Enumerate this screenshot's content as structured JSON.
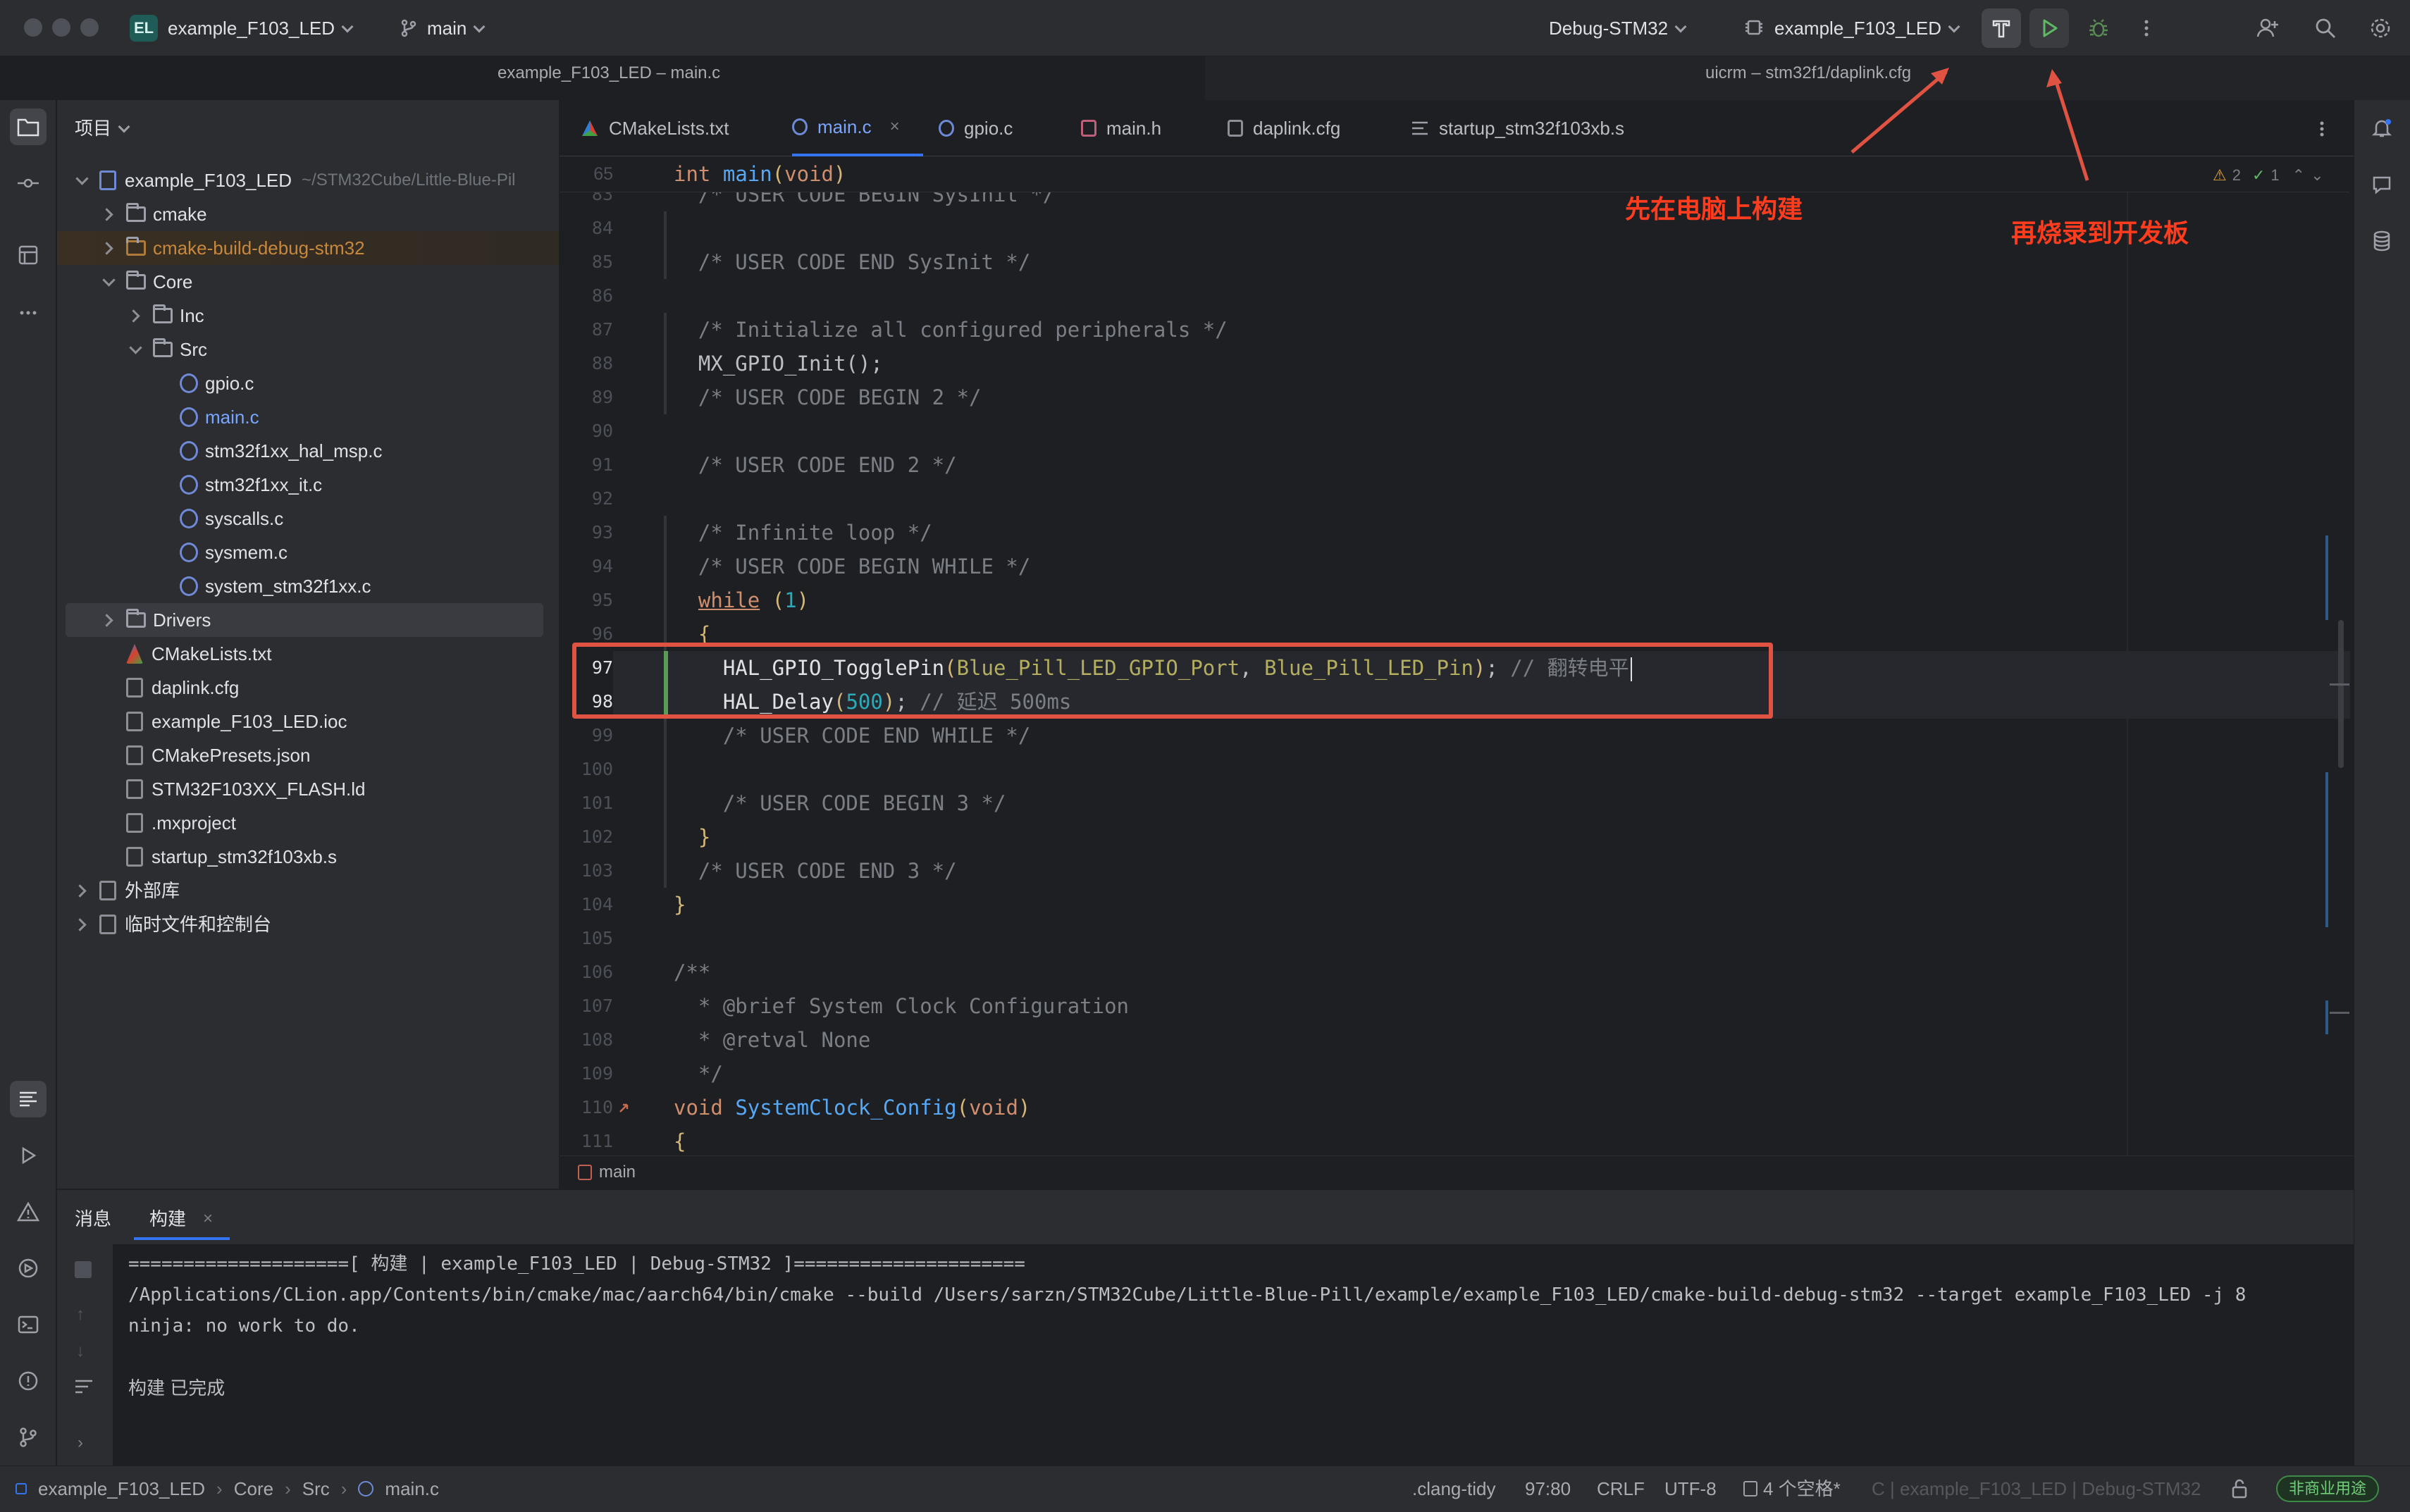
{
  "titlebar": {
    "project_badge": "EL",
    "project_name": "example_F103_LED",
    "branch": "main",
    "run_config": "Debug-STM32",
    "target": "example_F103_LED"
  },
  "subtitle": {
    "left": "example_F103_LED – main.c",
    "right": "uicrm – stm32f1/daplink.cfg"
  },
  "project_panel": {
    "header": "项目",
    "items": [
      {
        "label": "example_F103_LED",
        "suffix": "~/STM32Cube/Little-Blue-Pil",
        "depth": 0,
        "arrow": "down",
        "icon": "module",
        "style": "normal"
      },
      {
        "label": "cmake",
        "depth": 1,
        "arrow": "right",
        "icon": "folder",
        "style": "normal"
      },
      {
        "label": "cmake-build-debug-stm32",
        "depth": 1,
        "arrow": "right",
        "icon": "folder",
        "style": "excluded"
      },
      {
        "label": "Core",
        "depth": 1,
        "arrow": "down",
        "icon": "folder",
        "style": "normal"
      },
      {
        "label": "Inc",
        "depth": 2,
        "arrow": "right",
        "icon": "folder",
        "style": "normal"
      },
      {
        "label": "Src",
        "depth": 2,
        "arrow": "down",
        "icon": "folder",
        "style": "normal"
      },
      {
        "label": "gpio.c",
        "depth": 3,
        "arrow": "none",
        "icon": "c",
        "style": "normal"
      },
      {
        "label": "main.c",
        "depth": 3,
        "arrow": "none",
        "icon": "c",
        "style": "active"
      },
      {
        "label": "stm32f1xx_hal_msp.c",
        "depth": 3,
        "arrow": "none",
        "icon": "c",
        "style": "normal"
      },
      {
        "label": "stm32f1xx_it.c",
        "depth": 3,
        "arrow": "none",
        "icon": "c",
        "style": "normal"
      },
      {
        "label": "syscalls.c",
        "depth": 3,
        "arrow": "none",
        "icon": "c",
        "style": "normal"
      },
      {
        "label": "sysmem.c",
        "depth": 3,
        "arrow": "none",
        "icon": "c",
        "style": "normal"
      },
      {
        "label": "system_stm32f1xx.c",
        "depth": 3,
        "arrow": "none",
        "icon": "c",
        "style": "normal"
      },
      {
        "label": "Drivers",
        "depth": 1,
        "arrow": "right",
        "icon": "folder",
        "style": "selected"
      },
      {
        "label": "CMakeLists.txt",
        "depth": 1,
        "arrow": "none",
        "icon": "cmake",
        "style": "normal"
      },
      {
        "label": "daplink.cfg",
        "depth": 1,
        "arrow": "none",
        "icon": "file",
        "style": "normal"
      },
      {
        "label": "example_F103_LED.ioc",
        "depth": 1,
        "arrow": "none",
        "icon": "file",
        "style": "normal"
      },
      {
        "label": "CMakePresets.json",
        "depth": 1,
        "arrow": "none",
        "icon": "file",
        "style": "normal"
      },
      {
        "label": "STM32F103XX_FLASH.ld",
        "depth": 1,
        "arrow": "none",
        "icon": "file",
        "style": "normal"
      },
      {
        "label": ".mxproject",
        "depth": 1,
        "arrow": "none",
        "icon": "file",
        "style": "normal"
      },
      {
        "label": "startup_stm32f103xb.s",
        "depth": 1,
        "arrow": "none",
        "icon": "file",
        "style": "normal"
      },
      {
        "label": "外部库",
        "depth": 0,
        "arrow": "right",
        "icon": "lib",
        "style": "normal"
      },
      {
        "label": "临时文件和控制台",
        "depth": 0,
        "arrow": "right",
        "icon": "console",
        "style": "normal"
      }
    ]
  },
  "tabs": [
    {
      "label": "CMakeLists.txt",
      "active": false
    },
    {
      "label": "main.c",
      "active": true
    },
    {
      "label": "gpio.c",
      "active": false
    },
    {
      "label": "main.h",
      "active": false
    },
    {
      "label": "daplink.cfg",
      "active": false
    },
    {
      "label": "startup_stm32f103xb.s",
      "active": false
    }
  ],
  "editor": {
    "sticky_line_no": "65",
    "sticky_code": "int main(void)",
    "inspection_warnings": "2",
    "inspection_ok": "1",
    "breadcrumb": "main",
    "lines": [
      {
        "no": "83",
        "text": "  /* USER CODE BEGIN SysInit */",
        "kind": "comment"
      },
      {
        "no": "84",
        "text": "",
        "kind": "plain"
      },
      {
        "no": "85",
        "text": "  /* USER CODE END SysInit */",
        "kind": "comment"
      },
      {
        "no": "86",
        "text": "",
        "kind": "plain"
      },
      {
        "no": "87",
        "text": "  /* Initialize all configured peripherals */",
        "kind": "comment"
      },
      {
        "no": "88",
        "text": "  MX_GPIO_Init();",
        "kind": "plain"
      },
      {
        "no": "89",
        "text": "  /* USER CODE BEGIN 2 */",
        "kind": "comment"
      },
      {
        "no": "90",
        "text": "",
        "kind": "plain"
      },
      {
        "no": "91",
        "text": "  /* USER CODE END 2 */",
        "kind": "comment"
      },
      {
        "no": "92",
        "text": "",
        "kind": "plain"
      },
      {
        "no": "93",
        "text": "  /* Infinite loop */",
        "kind": "comment"
      },
      {
        "no": "94",
        "text": "  /* USER CODE BEGIN WHILE */",
        "kind": "comment"
      },
      {
        "no": "95",
        "text": "  while (1)",
        "kind": "while"
      },
      {
        "no": "96",
        "text": "  {",
        "kind": "brace"
      },
      {
        "no": "97",
        "text": "    HAL_GPIO_TogglePin(Blue_Pill_LED_GPIO_Port, Blue_Pill_LED_Pin); // 翻转电平",
        "kind": "toggle"
      },
      {
        "no": "98",
        "text": "    HAL_Delay(500); // 延迟 500ms",
        "kind": "delay"
      },
      {
        "no": "99",
        "text": "    /* USER CODE END WHILE */",
        "kind": "comment"
      },
      {
        "no": "100",
        "text": "",
        "kind": "plain"
      },
      {
        "no": "101",
        "text": "    /* USER CODE BEGIN 3 */",
        "kind": "comment"
      },
      {
        "no": "102",
        "text": "  }",
        "kind": "brace"
      },
      {
        "no": "103",
        "text": "  /* USER CODE END 3 */",
        "kind": "comment"
      },
      {
        "no": "104",
        "text": "}",
        "kind": "brace"
      },
      {
        "no": "105",
        "text": "",
        "kind": "plain"
      },
      {
        "no": "106",
        "text": "/**",
        "kind": "comment"
      },
      {
        "no": "107",
        "text": "  * @brief System Clock Configuration",
        "kind": "comment"
      },
      {
        "no": "108",
        "text": "  * @retval None",
        "kind": "comment"
      },
      {
        "no": "109",
        "text": "  */",
        "kind": "comment"
      },
      {
        "no": "110",
        "text": "void SystemClock_Config(void)",
        "kind": "func"
      },
      {
        "no": "111",
        "text": "{",
        "kind": "brace"
      }
    ]
  },
  "annotations": {
    "build_note": "先在电脑上构建",
    "flash_note": "再烧录到开发板"
  },
  "bottom_panel": {
    "tabs": [
      "消息",
      "构建"
    ],
    "output": [
      "====================[ 构建 | example_F103_LED | Debug-STM32 ]=====================",
      "/Applications/CLion.app/Contents/bin/cmake/mac/aarch64/bin/cmake --build /Users/sarzn/STM32Cube/Little-Blue-Pill/example/example_F103_LED/cmake-build-debug-stm32 --target example_F103_LED -j 8",
      "ninja: no work to do.",
      "",
      "构建 已完成"
    ]
  },
  "statusbar": {
    "breadcrumb": [
      "example_F103_LED",
      "Core",
      "Src",
      "main.c"
    ],
    "clang_tidy": ".clang-tidy",
    "position": "97:80",
    "line_sep": "CRLF",
    "encoding": "UTF-8",
    "indent": "4 个空格*",
    "context": "C | example_F103_LED | Debug-STM32",
    "license": "非商业用途"
  },
  "colors": {
    "accent": "#3574f0",
    "annotation_red": "#e05343",
    "run_green": "#5fb865"
  }
}
